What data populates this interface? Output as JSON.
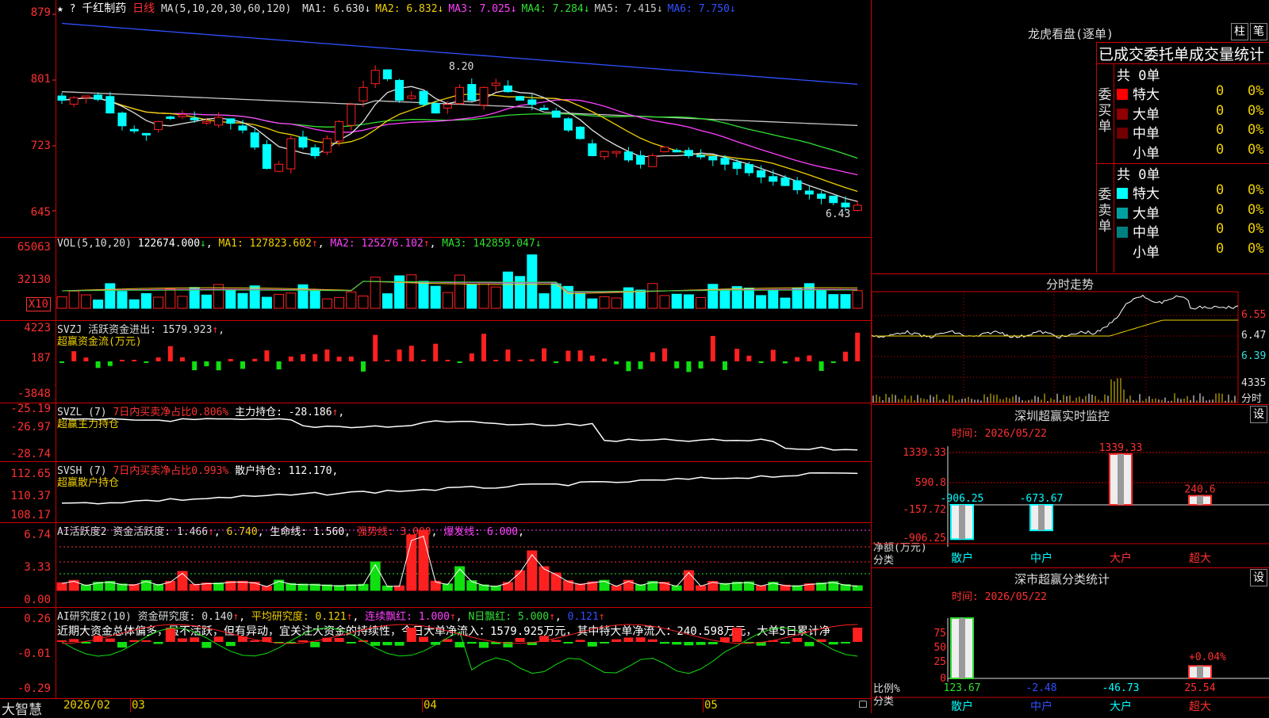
{
  "header": {
    "marks": "★ ?",
    "stock_name": "千红制药",
    "period": "日线",
    "ma_spec": "MA(5,10,20,30,60,120)",
    "ma_values": [
      {
        "label": "MA1:",
        "value": "6.630",
        "arrow": "↓",
        "color": "#e0e0e0"
      },
      {
        "label": "MA2:",
        "value": "6.832",
        "arrow": "↓",
        "color": "#f0d000"
      },
      {
        "label": "MA3:",
        "value": "7.025",
        "arrow": "↓",
        "color": "#ff40ff"
      },
      {
        "label": "MA4:",
        "value": "7.284",
        "arrow": "↓",
        "color": "#30e030"
      },
      {
        "label": "MA5:",
        "value": "7.415",
        "arrow": "↓",
        "color": "#c8c8c8"
      },
      {
        "label": "MA6:",
        "value": "7.750",
        "arrow": "↓",
        "color": "#3050ff"
      }
    ],
    "high_label": "8.20",
    "low_label": "6.43"
  },
  "price_axis": [
    "879",
    "801",
    "723",
    "645"
  ],
  "volume": {
    "title": "VOL(5,10,20)",
    "value": "122674.000",
    "ma1": "MA1: 127823.602",
    "ma2": "MA2: 125276.102",
    "ma3": "MA3: 142859.047",
    "axis": [
      "65063",
      "32130"
    ],
    "multiplier": "X10"
  },
  "svzj": {
    "title": "SVZJ  活跃资金进出: 1579.923",
    "subtitle": "超赢资金流(万元)",
    "axis": [
      "4223",
      "187",
      "-3848"
    ]
  },
  "svzl": {
    "title": "SVZL (7)",
    "ratio": "7日内买卖净占比0.806%",
    "hold": "主力持仓: -28.186",
    "subtitle": "超赢主力持仓",
    "axis": [
      "-25.19",
      "-26.97",
      "-28.74"
    ]
  },
  "svsh": {
    "title": "SVSH (7)",
    "ratio": "7日内买卖净占比0.993%",
    "hold": "散户持仓: 112.170",
    "subtitle": "超赢散户持仓",
    "axis": [
      "112.65",
      "110.37",
      "108.17"
    ]
  },
  "ai_active": {
    "t1": "AI活跃度2 资金活跃度: 1.466",
    "t2": "6.740",
    "t3": "生命线: 1.560",
    "t4": "强势线: 3.000",
    "t5": "爆发线: 6.000",
    "axis": [
      "6.74",
      "3.33",
      "0.00"
    ]
  },
  "ai_research": {
    "t1": "AI研究度2(10) 资金研究度: 0.140",
    "t2": "平均研究度: 0.121",
    "t3": "连续飘红: 1.000",
    "t4": "N日飘红: 5.000",
    "t5": "0.121",
    "comment": "近期大资金总体偏多，虽不活跃，但有异动，宜关注大资金的持续性，今日大单净流入：1579.925万元，其中特大单净流入：240.598万元，大单5日累计净",
    "axis": [
      "0.26",
      "-0.01",
      "-0.29"
    ]
  },
  "bottom_axis": {
    "brand": "大智慧",
    "dates": [
      "2026/02",
      "03",
      "04",
      "05"
    ]
  },
  "right": {
    "lhb_title": "龙虎看盘(逐单)",
    "btn_bar": "柱",
    "btn_pen": "笔",
    "table_title": "已成交委托单成交量统计",
    "buy": {
      "side": "委买单",
      "total": "共 0单",
      "rows": [
        {
          "label": "特大",
          "n": "0",
          "pct": "0%",
          "color": "#ff0000"
        },
        {
          "label": "大单",
          "n": "0",
          "pct": "0%",
          "color": "#900000"
        },
        {
          "label": "中单",
          "n": "0",
          "pct": "0%",
          "color": "#700000"
        },
        {
          "label": "小单",
          "n": "0",
          "pct": "0%",
          "color": "#000000"
        }
      ]
    },
    "sell": {
      "side": "委卖单",
      "total": "共 0单",
      "rows": [
        {
          "label": "特大",
          "n": "0",
          "pct": "0%",
          "color": "#00ffff"
        },
        {
          "label": "大单",
          "n": "0",
          "pct": "0%",
          "color": "#00a0a0"
        },
        {
          "label": "中单",
          "n": "0",
          "pct": "0%",
          "color": "#008080"
        },
        {
          "label": "小单",
          "n": "0",
          "pct": "0%",
          "color": "#000000"
        }
      ]
    },
    "intraday": {
      "title": "分时走势",
      "axis": [
        "6.55",
        "6.47",
        "6.39"
      ],
      "vol_label": "4335",
      "unit": "分时"
    },
    "monitor": {
      "title": "深圳超赢实时监控",
      "btn": "设",
      "time": "时间: 2026/05/22",
      "axis": [
        "1339.33",
        "590.8",
        "-157.72",
        "-906.25"
      ],
      "bars": [
        {
          "cat": "散户",
          "value": -906.25,
          "label": "-906.25"
        },
        {
          "cat": "中户",
          "value": -673.67,
          "label": "-673.67"
        },
        {
          "cat": "大户",
          "value": 1339.33,
          "label": "1339.33"
        },
        {
          "cat": "超大",
          "value": 240.6,
          "label": "240.6"
        }
      ],
      "ylabel": "净额(万元)",
      "xlabel": "分类"
    },
    "classify": {
      "title": "深市超赢分类统计",
      "btn": "设",
      "time": "时间: 2026/05/22",
      "axis": [
        "75",
        "50",
        "25",
        "0"
      ],
      "bars": [
        {
          "cat": "散户",
          "value": 123.67,
          "label": "123.67"
        },
        {
          "cat": "中户",
          "value": -2.48,
          "label": "-2.48"
        },
        {
          "cat": "大户",
          "value": -46.73,
          "label": "-46.73"
        },
        {
          "cat": "超大",
          "value": 25.54,
          "label": "25.54"
        }
      ],
      "pct_label": "+0.04%",
      "ylabel": "比例%",
      "xlabel": "分类"
    }
  },
  "colors": {
    "up": "#ff2020",
    "down": "#00ffff",
    "grid": "#c00000",
    "ma1": "#e0e0e0",
    "ma2": "#f0d000",
    "ma3": "#ff40ff",
    "ma4": "#30e030",
    "ma5": "#c8c8c8",
    "ma6": "#3050ff"
  }
}
